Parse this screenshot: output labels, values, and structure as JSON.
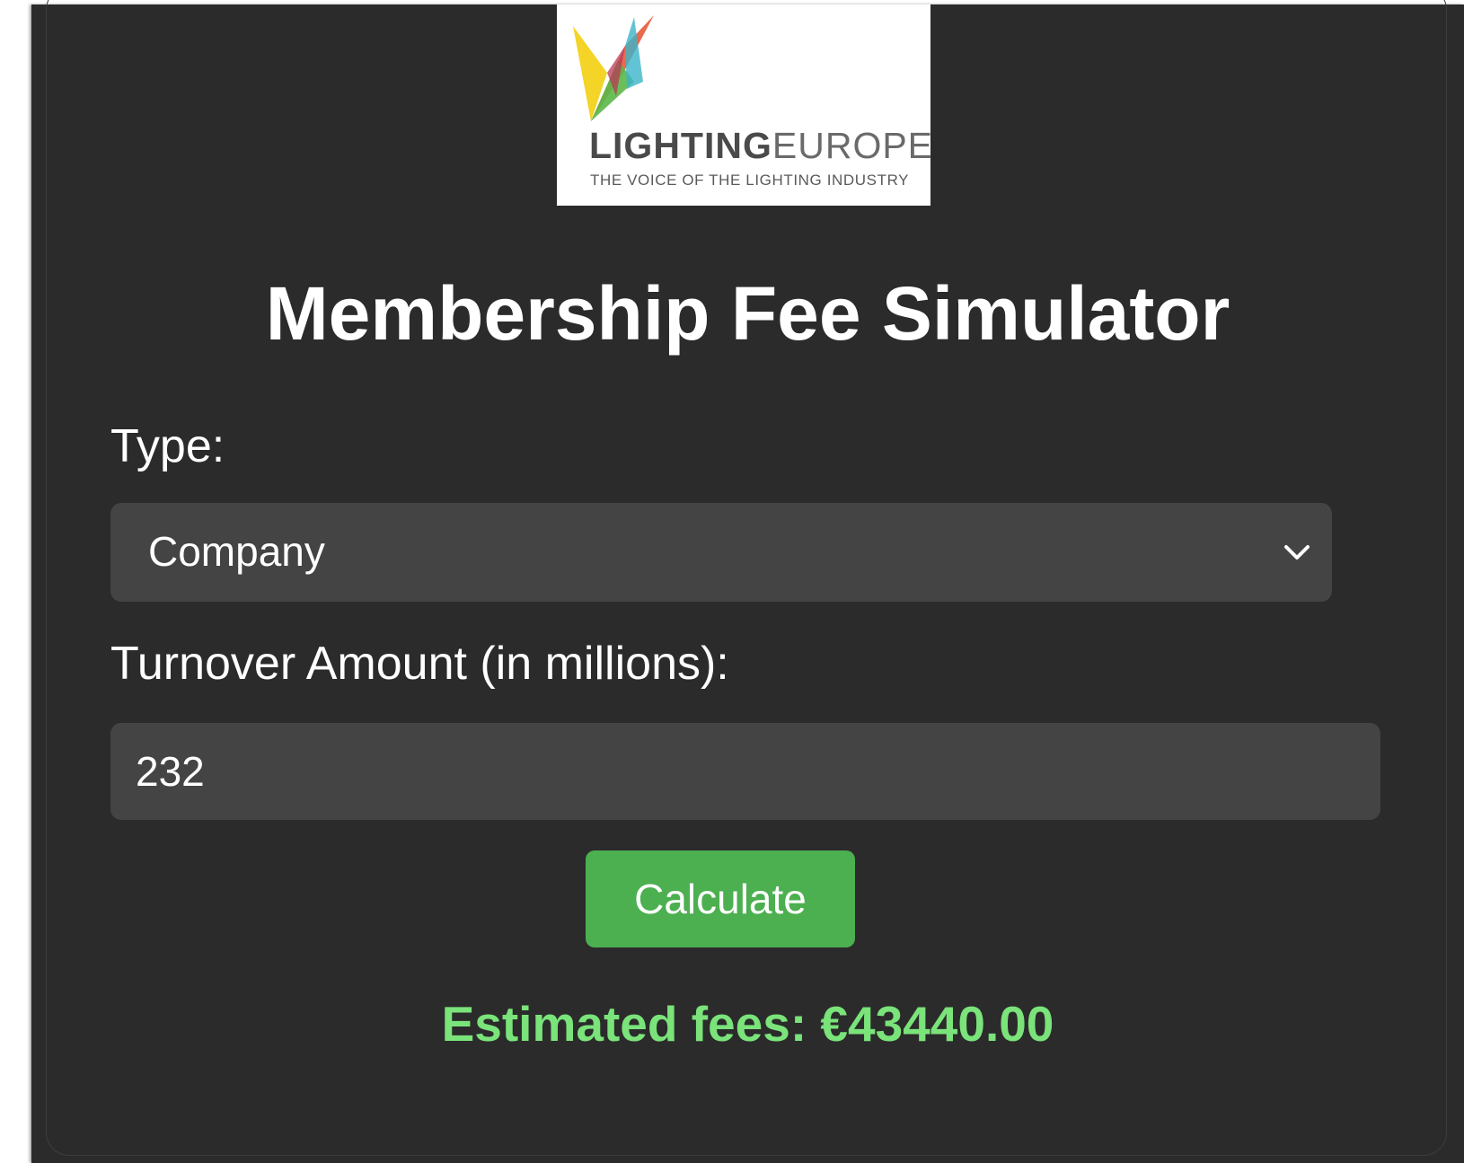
{
  "logo": {
    "wordmark_bold": "LIGHTING",
    "wordmark_light": "EUROPE",
    "tagline": "THE VOICE OF THE LIGHTING INDUSTRY",
    "colors": [
      "#f2d21b",
      "#e85a3a",
      "#5bb848",
      "#3ab4c8",
      "#b93a58"
    ]
  },
  "page": {
    "title": "Membership Fee Simulator"
  },
  "form": {
    "type_label": "Type:",
    "type_selected": "Company",
    "turnover_label": "Turnover Amount (in millions):",
    "turnover_value": "232",
    "calculate_label": "Calculate"
  },
  "result": {
    "text": "Estimated fees: €43440.00"
  },
  "colors": {
    "background": "#2b2b2b",
    "input_bg": "#444444",
    "button": "#4caf50",
    "result_text": "#7ae37a"
  }
}
